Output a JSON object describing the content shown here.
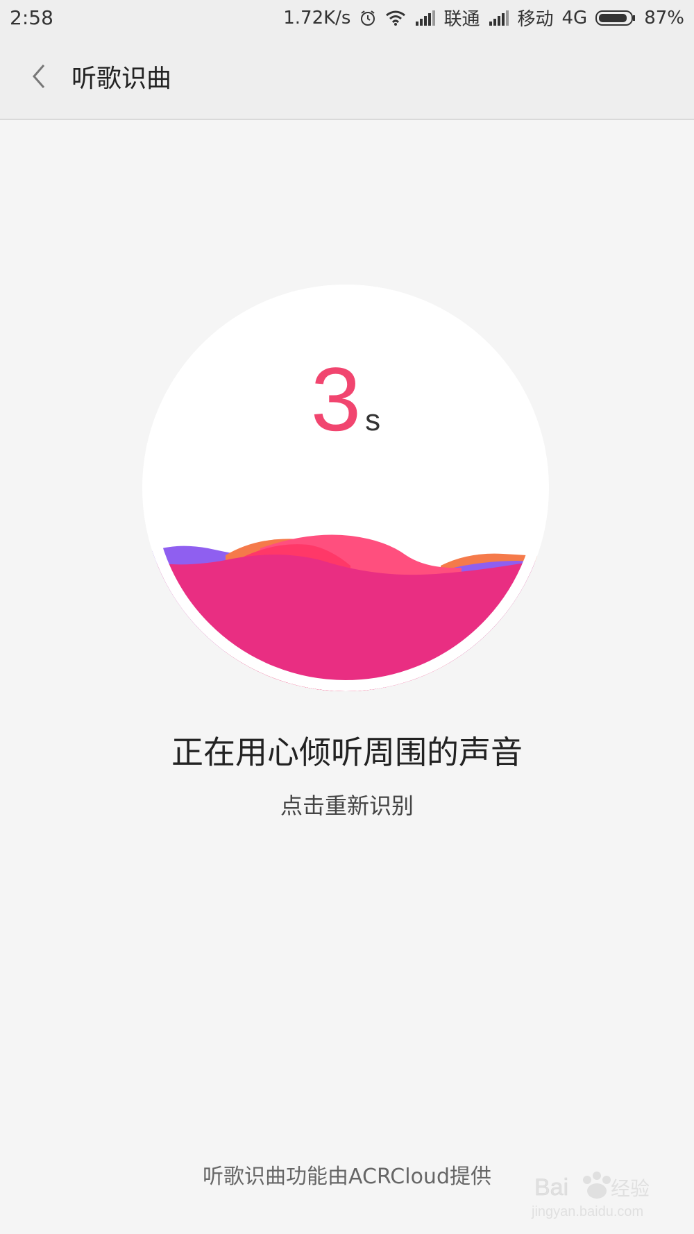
{
  "status_bar": {
    "time": "2:58",
    "speed": "1.72K/s",
    "carrier1": "联通",
    "carrier2": "移动",
    "network": "4G",
    "battery": "87%",
    "icons": [
      "alarm-icon",
      "wifi-icon",
      "signal-icon",
      "signal-icon",
      "battery-icon"
    ]
  },
  "header": {
    "title": "听歌识曲",
    "back_icon": "chevron-left-icon"
  },
  "recognizer": {
    "countdown_number": "3",
    "countdown_unit": "s",
    "status_text": "正在用心倾听周围的声音",
    "retry_label": "点击重新识别",
    "colors": {
      "accent": "#f1456f",
      "wave_main": "#e92e82",
      "wave_purple": "#8f5ff0",
      "wave_orange": "#f57a4a",
      "wave_pink": "#ff4f7e"
    }
  },
  "footer": {
    "credit": "听歌识曲功能由ACRCloud提供"
  },
  "watermark": {
    "text": "Bai经验",
    "url_text": "jingyan.baidu.com"
  }
}
